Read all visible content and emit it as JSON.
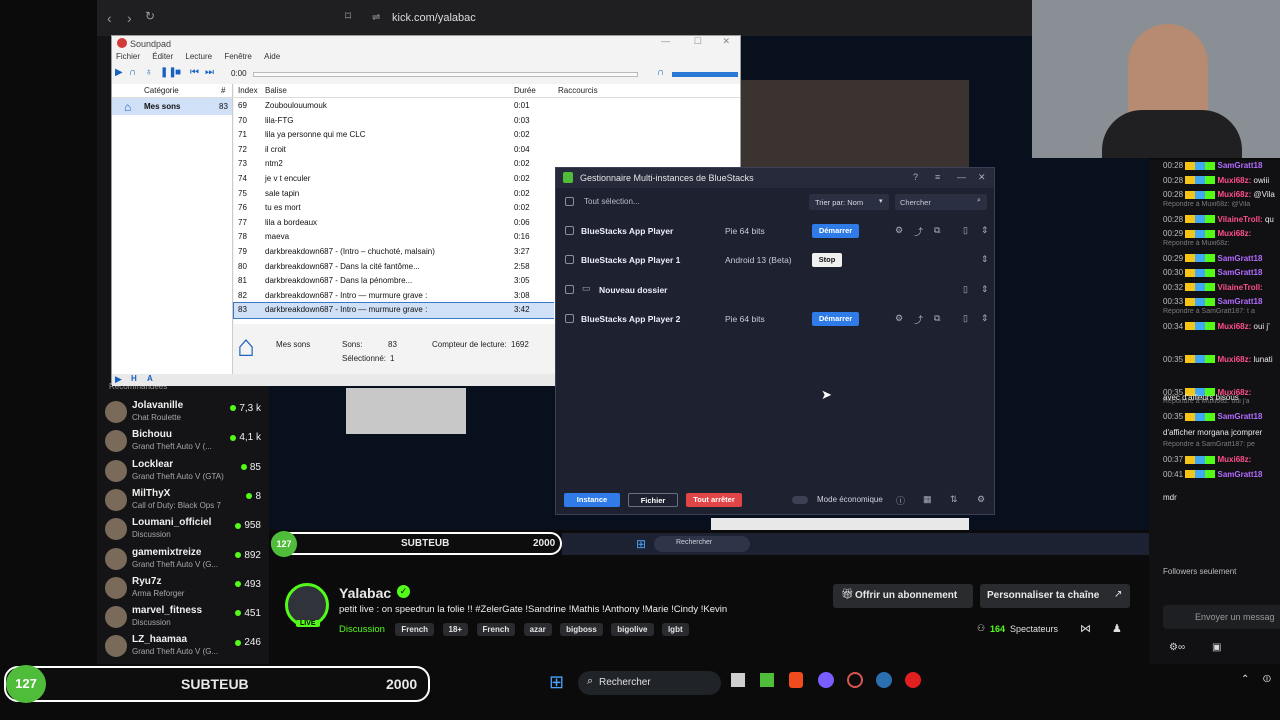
{
  "browser": {
    "url": "kick.com/yalabac"
  },
  "soundpad": {
    "title": "Soundpad",
    "menu": [
      "Fichier",
      "Éditer",
      "Lecture",
      "Fenêtre",
      "Aide"
    ],
    "time": "0:00",
    "headers": {
      "categorie": "Catégorie",
      "hash": "#",
      "index": "Index",
      "balise": "Balise",
      "duree": "Durée",
      "raccourcis": "Raccourcis"
    },
    "category": {
      "name": "Mes sons",
      "count": "83"
    },
    "rows": [
      {
        "idx": "69",
        "name": "Zouboulouumouk",
        "dur": "0:01"
      },
      {
        "idx": "70",
        "name": "lila-FTG",
        "dur": "0:03"
      },
      {
        "idx": "71",
        "name": "lila ya personne qui me CLC",
        "dur": "0:02"
      },
      {
        "idx": "72",
        "name": "il croit",
        "dur": "0:04"
      },
      {
        "idx": "73",
        "name": "ntm2",
        "dur": "0:02"
      },
      {
        "idx": "74",
        "name": "je v t enculer",
        "dur": "0:02"
      },
      {
        "idx": "75",
        "name": "sale tapin",
        "dur": "0:02"
      },
      {
        "idx": "76",
        "name": "tu es mort",
        "dur": "0:02"
      },
      {
        "idx": "77",
        "name": "lila a bordeaux",
        "dur": "0:06"
      },
      {
        "idx": "78",
        "name": "maeva",
        "dur": "0:16"
      },
      {
        "idx": "79",
        "name": "darkbreakdown687 - (Intro – chuchoté, malsain)",
        "dur": "3:27"
      },
      {
        "idx": "80",
        "name": "darkbreakdown687 - Dans la cité fantôme...",
        "dur": "2:58"
      },
      {
        "idx": "81",
        "name": "darkbreakdown687 - Dans la pénombre...",
        "dur": "3:05"
      },
      {
        "idx": "82",
        "name": "darkbreakdown687 - Intro — murmure grave :",
        "dur": "3:08"
      },
      {
        "idx": "83",
        "name": "darkbreakdown687 - Intro — murmure grave :",
        "dur": "3:42"
      }
    ],
    "status": {
      "name": "Mes sons",
      "sons_label": "Sons:",
      "sons": "83",
      "sel_label": "Sélectionné:",
      "sel": "1",
      "counter_label": "Compteur de lecture:",
      "counter": "1692"
    }
  },
  "sidebar": {
    "section": "Recommandées",
    "items": [
      {
        "name": "Jolavanille",
        "game": "Chat Roulette",
        "count": "7,3 k"
      },
      {
        "name": "Bichouu",
        "game": "Grand Theft Auto V (...",
        "count": "4,1 k"
      },
      {
        "name": "Locklear",
        "game": "Grand Theft Auto V (GTA)",
        "count": "85"
      },
      {
        "name": "MilThyX",
        "game": "Call of Duty: Black Ops 7",
        "count": "8"
      },
      {
        "name": "Loumani_officiel",
        "game": "Discussion",
        "count": "958"
      },
      {
        "name": "gamemixtreize",
        "game": "Grand Theft Auto V (G...",
        "count": "892"
      },
      {
        "name": "Ryu7z",
        "game": "Arma Reforger",
        "count": "493"
      },
      {
        "name": "marvel_fitness",
        "game": "Discussion",
        "count": "451"
      },
      {
        "name": "LZ_haamaa",
        "game": "Grand Theft Auto V (G...",
        "count": "246"
      }
    ]
  },
  "bluestacks": {
    "title": "Gestionnaire Multi-instances de BlueStacks",
    "select_all": "Tout sélection...",
    "sort": "Trier par: Nom",
    "search": "Chercher",
    "instances": [
      {
        "name": "BlueStacks App Player",
        "arch": "Pie 64 bits",
        "action": "Démarrer"
      },
      {
        "name": "BlueStacks App Player 1",
        "arch": "Android 13 (Beta)",
        "action": "Stop"
      },
      {
        "name": "Nouveau dossier",
        "arch": "",
        "action": ""
      },
      {
        "name": "BlueStacks App Player 2",
        "arch": "Pie 64 bits",
        "action": "Démarrer"
      }
    ],
    "footer": {
      "instance": "Instance",
      "fichier": "Fichier",
      "stop_all": "Tout arrêter",
      "eco": "Mode économique"
    }
  },
  "subgoal": {
    "count": "127",
    "label": "SUBTEUB",
    "goal": "2000"
  },
  "taskbar": {
    "search": "Rechercher"
  },
  "channel": {
    "name": "Yalabac",
    "live": "LIVE",
    "title": "petit live : on speedrun la folie !! #ZelerGate !Sandrine !Mathis !Anthony !Marie !Cindy !Kevin",
    "category": "Discussion",
    "tags": [
      "French",
      "18+",
      "French",
      "azar",
      "bigboss",
      "bigolive",
      "lgbt"
    ],
    "subscribe": "Offrir un abonnement",
    "customize": "Personnaliser ta chaîne",
    "viewers": "164",
    "viewers_label": "Spectateurs"
  },
  "chat": {
    "lines": [
      {
        "time": "00:28",
        "user": "SamGratt18",
        "msg": "",
        "color": "#b36cff"
      },
      {
        "time": "00:28",
        "user": "Muxi68z:",
        "msg": "owiii",
        "color": "#ff4f8b"
      },
      {
        "time": "00:28",
        "user": "Muxi68z:",
        "msg": "@Vila",
        "color": "#ff4f8b"
      },
      {
        "time": "00:28",
        "user": "VilaineTroll:",
        "msg": "qu",
        "color": "#ff4f8b",
        "reply": "Répondre à Muxi68z: @Vila"
      },
      {
        "time": "00:29",
        "user": "Muxi68z:",
        "msg": "",
        "color": "#ff4f8b"
      },
      {
        "time": "00:29",
        "user": "SamGratt18",
        "msg": "",
        "color": "#b36cff",
        "reply": "Répondre à Muxi68z:"
      },
      {
        "time": "00:30",
        "user": "SamGratt18",
        "msg": "",
        "color": "#b36cff"
      },
      {
        "time": "00:32",
        "user": "VilaineTroll:",
        "msg": "",
        "color": "#ff4f8b"
      },
      {
        "time": "00:33",
        "user": "SamGratt18",
        "msg": "",
        "color": "#b36cff"
      },
      {
        "time": "00:34",
        "user": "Muxi68z:",
        "msg": "oui j'",
        "color": "#ff4f8b",
        "reply": "Répondre à SamGratt187: t a"
      },
      {
        "time": "00:35",
        "user": "Muxi68z:",
        "msg": "lunati",
        "color": "#ff4f8b"
      },
      {
        "time": "00:35",
        "user": "Muxi68z:",
        "msg": "",
        "color": "#ff4f8b"
      },
      {
        "time": "00:35",
        "user": "SamGratt18",
        "msg": "",
        "color": "#b36cff",
        "reply": "Répondre à Muxi68z: oui j'a"
      },
      {
        "time": "00:37",
        "user": "Muxi68z:",
        "msg": "",
        "color": "#ff4f8b",
        "reply": "Répondre à SamGratt187: pe"
      },
      {
        "time": "00:41",
        "user": "SamGratt18",
        "msg": "",
        "color": "#b36cff"
      }
    ],
    "extra": [
      "avec d'ailleurs bisous",
      "d'afficher morgana jcomprer",
      "mdr"
    ],
    "followers": "Followers seulement",
    "input": "Envoyer un messag"
  }
}
